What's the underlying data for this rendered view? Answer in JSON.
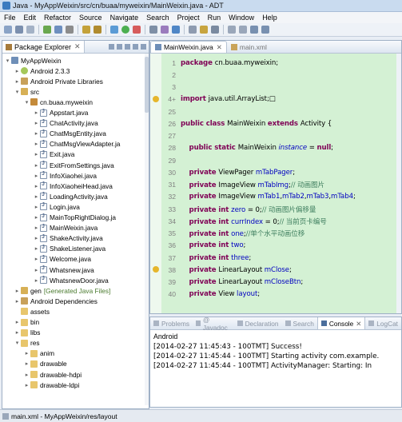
{
  "window": {
    "title": "Java - MyAppWeixin/src/cn/buaa/myweixin/MainWeixin.java - ADT"
  },
  "menu": [
    "File",
    "Edit",
    "Refactor",
    "Source",
    "Navigate",
    "Search",
    "Project",
    "Run",
    "Window",
    "Help"
  ],
  "package_explorer": {
    "tab_label": "Package Explorer",
    "close": "✕",
    "tree": [
      {
        "label": "MyAppWeixin",
        "icon": "project-icon",
        "depth": 0,
        "twisty": "▾"
      },
      {
        "label": "Android 2.3.3",
        "icon": "android-icon",
        "depth": 1,
        "twisty": "▸"
      },
      {
        "label": "Android Private Libraries",
        "icon": "library-icon",
        "depth": 1,
        "twisty": "▸"
      },
      {
        "label": "src",
        "icon": "source-folder-icon",
        "depth": 1,
        "twisty": "▾"
      },
      {
        "label": "cn.buaa.myweixin",
        "icon": "package-icon",
        "depth": 2,
        "twisty": "▾"
      },
      {
        "label": "Appstart.java",
        "icon": "java-file-icon",
        "depth": 3,
        "twisty": "▸"
      },
      {
        "label": "ChatActivity.java",
        "icon": "java-file-icon",
        "depth": 3,
        "twisty": "▸"
      },
      {
        "label": "ChatMsgEntity.java",
        "icon": "java-file-icon",
        "depth": 3,
        "twisty": "▸"
      },
      {
        "label": "ChatMsgViewAdapter.ja",
        "icon": "java-file-icon",
        "depth": 3,
        "twisty": "▸"
      },
      {
        "label": "Exit.java",
        "icon": "java-file-icon",
        "depth": 3,
        "twisty": "▸"
      },
      {
        "label": "ExitFromSettings.java",
        "icon": "java-file-icon",
        "depth": 3,
        "twisty": "▸"
      },
      {
        "label": "InfoXiaohei.java",
        "icon": "java-file-icon",
        "depth": 3,
        "twisty": "▸"
      },
      {
        "label": "InfoXiaoheiHead.java",
        "icon": "java-file-icon",
        "depth": 3,
        "twisty": "▸"
      },
      {
        "label": "LoadingActivity.java",
        "icon": "java-file-icon",
        "depth": 3,
        "twisty": "▸"
      },
      {
        "label": "Login.java",
        "icon": "java-file-icon",
        "depth": 3,
        "twisty": "▸"
      },
      {
        "label": "MainTopRightDialog.ja",
        "icon": "java-file-icon",
        "depth": 3,
        "twisty": "▸"
      },
      {
        "label": "MainWeixin.java",
        "icon": "java-file-icon",
        "depth": 3,
        "twisty": "▸"
      },
      {
        "label": "ShakeActivity.java",
        "icon": "java-file-icon",
        "depth": 3,
        "twisty": "▸"
      },
      {
        "label": "ShakeListener.java",
        "icon": "java-file-icon",
        "depth": 3,
        "twisty": "▸"
      },
      {
        "label": "Welcome.java",
        "icon": "java-file-icon",
        "depth": 3,
        "twisty": "▸"
      },
      {
        "label": "Whatsnew.java",
        "icon": "java-file-icon",
        "depth": 3,
        "twisty": "▸"
      },
      {
        "label": "WhatsnewDoor.java",
        "icon": "java-file-icon",
        "depth": 3,
        "twisty": "▸"
      },
      {
        "label": "gen",
        "suffix": "[Generated Java Files]",
        "icon": "source-folder-icon",
        "depth": 1,
        "twisty": "▸"
      },
      {
        "label": "Android Dependencies",
        "icon": "library-icon",
        "depth": 1,
        "twisty": "▸"
      },
      {
        "label": "assets",
        "icon": "folder-icon",
        "depth": 1,
        "twisty": ""
      },
      {
        "label": "bin",
        "icon": "folder-icon",
        "depth": 1,
        "twisty": "▸"
      },
      {
        "label": "libs",
        "icon": "folder-icon",
        "depth": 1,
        "twisty": "▸"
      },
      {
        "label": "res",
        "icon": "folder-icon",
        "depth": 1,
        "twisty": "▾"
      },
      {
        "label": "anim",
        "icon": "folder-icon",
        "depth": 2,
        "twisty": "▸"
      },
      {
        "label": "drawable",
        "icon": "folder-icon",
        "depth": 2,
        "twisty": "▸"
      },
      {
        "label": "drawable-hdpi",
        "icon": "folder-icon",
        "depth": 2,
        "twisty": "▸"
      },
      {
        "label": "drawable-ldpi",
        "icon": "folder-icon",
        "depth": 2,
        "twisty": "▸"
      }
    ]
  },
  "editor": {
    "tabs": [
      {
        "label": "MainWeixin.java",
        "active": true,
        "close": "✕"
      },
      {
        "label": "main.xml",
        "active": false
      }
    ],
    "lines": [
      {
        "num": "1",
        "segs": [
          [
            "kw",
            "package "
          ],
          [
            "",
            "cn.buaa.myweixin;"
          ]
        ]
      },
      {
        "num": "2",
        "segs": []
      },
      {
        "num": "3",
        "segs": []
      },
      {
        "num": "4+",
        "segs": [
          [
            "kw",
            "import "
          ],
          [
            "",
            "java.util.ArrayList;"
          ],
          [
            "",
            "□"
          ]
        ],
        "marker": true
      },
      {
        "num": "25",
        "segs": []
      },
      {
        "num": "26",
        "segs": [
          [
            "kw",
            "public class "
          ],
          [
            "",
            "MainWeixin "
          ],
          [
            "kw",
            "extends "
          ],
          [
            "",
            "Activity {"
          ]
        ]
      },
      {
        "num": "27",
        "segs": []
      },
      {
        "num": "28",
        "segs": [
          [
            "",
            "    "
          ],
          [
            "kw",
            "public static "
          ],
          [
            "",
            "MainWeixin "
          ],
          [
            "sfld",
            "instance"
          ],
          [
            "",
            " = "
          ],
          [
            "kw",
            "null"
          ],
          [
            "",
            ";"
          ]
        ]
      },
      {
        "num": "29",
        "segs": []
      },
      {
        "num": "30",
        "segs": [
          [
            "",
            "    "
          ],
          [
            "kw",
            "private "
          ],
          [
            "",
            "ViewPager "
          ],
          [
            "fld",
            "mTabPager"
          ],
          [
            "",
            ";"
          ]
        ]
      },
      {
        "num": "31",
        "segs": [
          [
            "",
            "    "
          ],
          [
            "kw",
            "private "
          ],
          [
            "",
            "ImageView "
          ],
          [
            "fld",
            "mTabImg"
          ],
          [
            "",
            ";"
          ],
          [
            "cmt",
            "// 动画图片"
          ]
        ]
      },
      {
        "num": "32",
        "segs": [
          [
            "",
            "    "
          ],
          [
            "kw",
            "private "
          ],
          [
            "",
            "ImageView "
          ],
          [
            "fld",
            "mTab1"
          ],
          [
            "",
            ","
          ],
          [
            "fld",
            "mTab2"
          ],
          [
            "",
            ","
          ],
          [
            "fld",
            "mTab3"
          ],
          [
            "",
            ","
          ],
          [
            "fld",
            "mTab4"
          ],
          [
            "",
            ";"
          ]
        ]
      },
      {
        "num": "33",
        "segs": [
          [
            "",
            "    "
          ],
          [
            "kw",
            "private int "
          ],
          [
            "fld",
            "zero"
          ],
          [
            "",
            " = 0;"
          ],
          [
            "cmt",
            "// 动画图片偏移量"
          ]
        ]
      },
      {
        "num": "34",
        "segs": [
          [
            "",
            "    "
          ],
          [
            "kw",
            "private int "
          ],
          [
            "fld",
            "currIndex"
          ],
          [
            "",
            " = 0;"
          ],
          [
            "cmt",
            "// 当前页卡编号"
          ]
        ]
      },
      {
        "num": "35",
        "segs": [
          [
            "",
            "    "
          ],
          [
            "kw",
            "private int "
          ],
          [
            "fld",
            "one"
          ],
          [
            "",
            ";"
          ],
          [
            "cmt",
            "//单个水平动画位移"
          ]
        ]
      },
      {
        "num": "36",
        "segs": [
          [
            "",
            "    "
          ],
          [
            "kw",
            "private int "
          ],
          [
            "fld",
            "two"
          ],
          [
            "",
            ";"
          ]
        ]
      },
      {
        "num": "37",
        "segs": [
          [
            "",
            "    "
          ],
          [
            "kw",
            "private int "
          ],
          [
            "fld",
            "three"
          ],
          [
            "",
            ";"
          ]
        ]
      },
      {
        "num": "38",
        "segs": [
          [
            "",
            "    "
          ],
          [
            "kw",
            "private "
          ],
          [
            "",
            "LinearLayout "
          ],
          [
            "fld",
            "mClose"
          ],
          [
            "",
            ";"
          ]
        ],
        "marker": true
      },
      {
        "num": "39",
        "segs": [
          [
            "",
            "    "
          ],
          [
            "kw",
            "private "
          ],
          [
            "",
            "LinearLayout "
          ],
          [
            "fld",
            "mCloseBtn"
          ],
          [
            "",
            ";"
          ]
        ]
      },
      {
        "num": "40",
        "segs": [
          [
            "",
            "    "
          ],
          [
            "kw",
            "private "
          ],
          [
            "",
            "View "
          ],
          [
            "fld",
            "layout"
          ],
          [
            "",
            ";"
          ]
        ]
      }
    ]
  },
  "console": {
    "tabs": [
      {
        "label": "Problems",
        "active": false
      },
      {
        "label": "@ Javadoc",
        "active": false
      },
      {
        "label": "Declaration",
        "active": false
      },
      {
        "label": "Search",
        "active": false
      },
      {
        "label": "Console",
        "active": true,
        "close": "✕"
      },
      {
        "label": "LogCat",
        "active": false
      }
    ],
    "title": "Android",
    "lines": [
      "[2014-02-27 11:45:43 - 100TMT] Success!",
      "[2014-02-27 11:45:44 - 100TMT] Starting activity com.example.",
      "[2014-02-27 11:45:44 - 100TMT] ActivityManager: Starting: In"
    ]
  },
  "statusbar": {
    "text": "main.xml - MyAppWeixin/res/layout"
  },
  "colors": {
    "keyword": "#7f0055",
    "field": "#0000c0",
    "comment": "#3f7f5f",
    "editor_bg": "#d4f1d4"
  }
}
